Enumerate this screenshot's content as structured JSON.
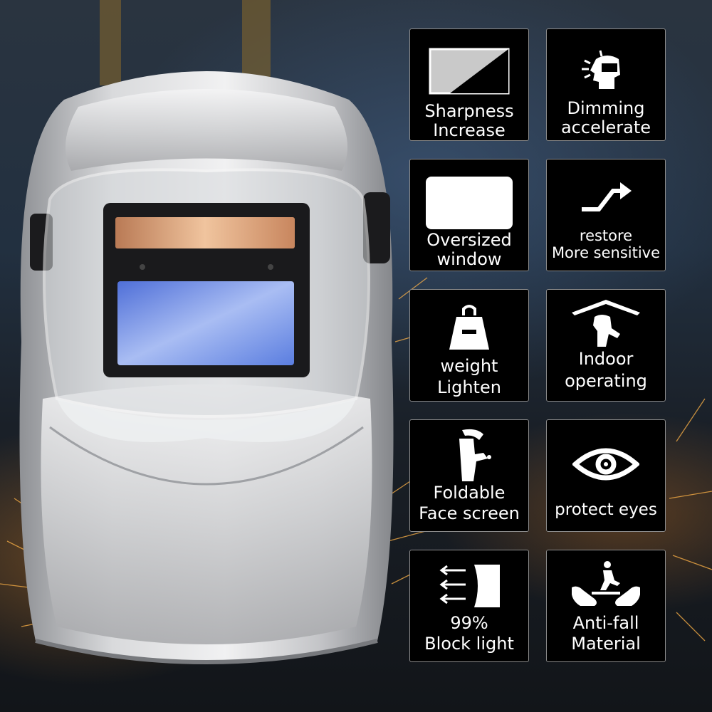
{
  "features": [
    {
      "id": "sharpness",
      "icon": "sharpness-icon",
      "lines": [
        "Sharpness",
        "Increase"
      ]
    },
    {
      "id": "dimming",
      "icon": "dimming-head-icon",
      "lines": [
        "Dimming",
        "accelerate"
      ]
    },
    {
      "id": "window",
      "icon": "oversized-window-icon",
      "lines": [
        "Oversized",
        "window"
      ]
    },
    {
      "id": "restore",
      "icon": "restore-arrow-icon",
      "lines": [
        "restore",
        "More sensitive"
      ]
    },
    {
      "id": "weight",
      "icon": "weight-icon",
      "lines": [
        "weight",
        "Lighten"
      ]
    },
    {
      "id": "indoor",
      "icon": "indoor-operating-icon",
      "lines": [
        "Indoor",
        "operating"
      ]
    },
    {
      "id": "foldable",
      "icon": "foldable-mask-icon",
      "lines": [
        "Foldable",
        "Face screen"
      ]
    },
    {
      "id": "eyes",
      "icon": "eye-icon",
      "lines": [
        "protect eyes"
      ]
    },
    {
      "id": "block",
      "icon": "block-light-icon",
      "lines": [
        "99%",
        "Block light"
      ]
    },
    {
      "id": "antifall",
      "icon": "anti-fall-icon",
      "lines": [
        "Anti-fall",
        "Material"
      ]
    }
  ],
  "colors": {
    "tile_bg": "#000000",
    "tile_border": "#8c8c8c",
    "helmet_silver": "#c8c9cb",
    "lens_blue": "#6f8fe6"
  }
}
